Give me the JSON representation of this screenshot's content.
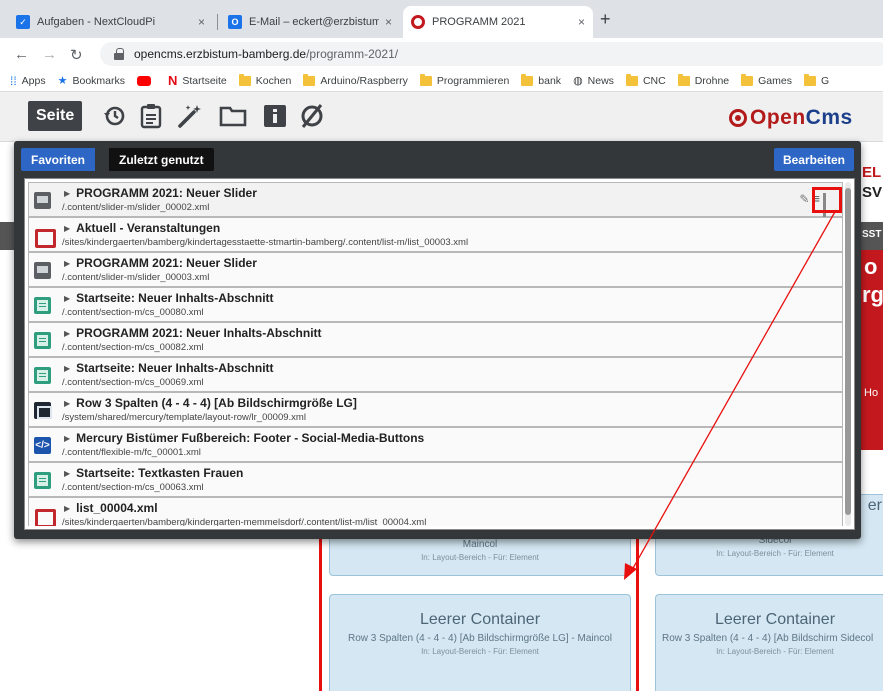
{
  "browser": {
    "tabs": [
      {
        "label": "Aufgaben - NextCloudPi",
        "close": "×",
        "favicon_color": "#1a73e8"
      },
      {
        "label": "E-Mail – eckert@erzbistum-bamb",
        "close": "×",
        "favicon_color": "#1a73e8"
      },
      {
        "label": "PROGRAMM 2021",
        "close": "×",
        "favicon_color": "#c3181d"
      }
    ],
    "newtab": "+",
    "url_domain": "opencms.erzbistum-bamberg.de",
    "url_path": "/programm-2021/",
    "bookmarks": [
      {
        "label": "Apps",
        "icon": "apps-grid-icon"
      },
      {
        "label": "Bookmarks",
        "icon": "star-icon"
      },
      {
        "label": "",
        "icon": "youtube-icon"
      },
      {
        "label": "Startseite",
        "icon": "netflix-icon"
      },
      {
        "label": "Kochen",
        "icon": "folder-icon"
      },
      {
        "label": "Arduino/Raspberry",
        "icon": "folder-icon"
      },
      {
        "label": "Programmieren",
        "icon": "folder-icon"
      },
      {
        "label": "bank",
        "icon": "folder-icon"
      },
      {
        "label": "News",
        "icon": "globe-icon"
      },
      {
        "label": "CNC",
        "icon": "folder-icon"
      },
      {
        "label": "Drohne",
        "icon": "folder-icon"
      },
      {
        "label": "Games",
        "icon": "folder-icon"
      },
      {
        "label": "G",
        "icon": "folder-icon"
      }
    ]
  },
  "cms_toolbar": {
    "seite_label": "Seite",
    "logo_open": "Open",
    "logo_cms": "Cms",
    "icons": [
      "history-icon",
      "clipboard-icon",
      "magic-wand-icon",
      "folder-icon",
      "info-icon",
      "disabled-icon"
    ]
  },
  "panel": {
    "tab_favorites": "Favoriten",
    "tab_recent": "Zuletzt genutzt",
    "edit_button": "Bearbeiten",
    "rows": [
      {
        "title": "PROGRAMM 2021: Neuer Slider",
        "path": "/.content/slider-m/slider_00002.xml",
        "icon": "slider-icon"
      },
      {
        "title": "Aktuell - Veranstaltungen",
        "path": "/sites/kindergaerten/bamberg/kindertagesstaette-stmartin-bamberg/.content/list-m/list_00003.xml",
        "icon": "list-icon"
      },
      {
        "title": "PROGRAMM 2021: Neuer Slider",
        "path": "/.content/slider-m/slider_00003.xml",
        "icon": "slider-icon"
      },
      {
        "title": "Startseite: Neuer Inhalts-Abschnitt",
        "path": "/.content/section-m/cs_00080.xml",
        "icon": "section-icon"
      },
      {
        "title": "PROGRAMM 2021: Neuer Inhalts-Abschnitt",
        "path": "/.content/section-m/cs_00082.xml",
        "icon": "section-icon"
      },
      {
        "title": "Startseite: Neuer Inhalts-Abschnitt",
        "path": "/.content/section-m/cs_00069.xml",
        "icon": "section-icon"
      },
      {
        "title": "Row 3 Spalten (4 - 4 - 4) [Ab Bildschirmgröße LG]",
        "path": "/system/shared/mercury/template/layout-row/lr_00009.xml",
        "icon": "layout-row-icon"
      },
      {
        "title": "Mercury Bistümer Fußbereich: Footer - Social-Media-Buttons",
        "path": "/.content/flexible-m/fc_00001.xml",
        "icon": "flexible-code-icon"
      },
      {
        "title": "Startseite: Textkasten Frauen",
        "path": "/.content/section-m/cs_00063.xml",
        "icon": "section-icon"
      },
      {
        "title": "list_00004.xml",
        "path": "/sites/kindergaerten/bamberg/kindergarten-memmelsdorf/.content/list-m/list_00004.xml",
        "icon": "list-icon"
      }
    ]
  },
  "page": {
    "containers": [
      {
        "title": "",
        "desc": "Maincol",
        "meta": "In: Layout-Bereich - Für: Element"
      },
      {
        "title": "er",
        "desc": "Sidecol",
        "meta": "In: Layout-Bereich - Für: Element"
      },
      {
        "title": "Leerer Container",
        "desc": "Row 3 Spalten (4 - 4 - 4) [Ab Bildschirmgröße LG] - Maincol",
        "meta": "In: Layout-Bereich - Für: Element"
      },
      {
        "title": "Leerer Container",
        "desc": "Row 3 Spalten (4 - 4 - 4) [Ab Bildschirm Sidecol",
        "meta": "In: Layout-Bereich - Für: Element"
      }
    ],
    "bg_snippets": [
      "EL",
      "SV",
      "SST",
      "o",
      "rg",
      "Ho"
    ]
  },
  "colors": {
    "accent_blue": "#2d66c4",
    "highlight_red": "#e8100e",
    "container_bg": "#d4e7f2"
  }
}
